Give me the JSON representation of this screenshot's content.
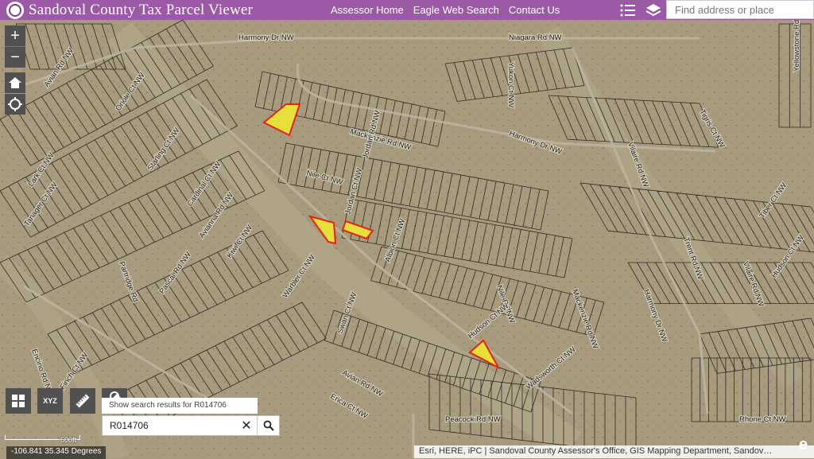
{
  "header": {
    "title": "Sandoval County Tax Parcel Viewer",
    "nav": [
      "Assessor Home",
      "Eagle Web Search",
      "Contact Us"
    ],
    "search_placeholder": "Find address or place"
  },
  "map_controls": {
    "zoom_in": "+",
    "zoom_out": "−"
  },
  "toolbar": {
    "xyz_label": "XYZ"
  },
  "search": {
    "tooltip": "Show search results for R014706",
    "value": "R014706",
    "clear": "✕"
  },
  "scale": {
    "label": "600ft"
  },
  "coords": "-106.841 35.345 Degrees",
  "attribution": "Esri, HERE, iPC | Sandoval County Assessor's Office, GIS Mapping Department, Sandov…",
  "colors": {
    "header": "#9b59a6",
    "parcel_highlight_fill": "#e7e03a",
    "parcel_highlight_stroke": "#e3241b",
    "terrain": "#a89a7c"
  },
  "map_labels": [
    {
      "name": "street-label-harmony-dr-nw-1",
      "text": "Harmony Dr NW"
    },
    {
      "name": "street-label-niagara-rd-nw",
      "text": "Niagara Rd NW"
    },
    {
      "name": "street-label-yukon-ct-nw",
      "text": "Yukon Ct NW"
    },
    {
      "name": "street-label-avian-rd-nw-1",
      "text": "Avian Rd NW"
    },
    {
      "name": "street-label-oriole-ct-nw",
      "text": "Oriole Ct NW"
    },
    {
      "name": "street-label-mackenzie-rd-nw-1",
      "text": "Mackenzie Rd NW"
    },
    {
      "name": "street-label-harmony-dr-nw-2",
      "text": "Harmony Dr NW"
    },
    {
      "name": "street-label-nile-ct-nw",
      "text": "Nile Ct NW"
    },
    {
      "name": "street-label-jordan-rd-nw",
      "text": "Jordan Rd NW"
    },
    {
      "name": "street-label-jordan-ct-nw",
      "text": "Jordan Ct NW"
    },
    {
      "name": "street-label-albion-ct-nw",
      "text": "Albion Ct NW"
    },
    {
      "name": "street-label-starling-ct-nw",
      "text": "Starling Ct NW"
    },
    {
      "name": "street-label-cardinal-ct-nw",
      "text": "Cardinal Ct NW"
    },
    {
      "name": "street-label-avianna-rd-nw",
      "text": "Avianna Rd NW"
    },
    {
      "name": "street-label-kiwi-ct-nw",
      "text": "Kiwi Ct NW"
    },
    {
      "name": "street-label-partridge-rd",
      "text": "Partridge Rd"
    },
    {
      "name": "street-label-pascal-rd-nw",
      "text": "Pascal Rd NW"
    },
    {
      "name": "street-label-warbler-ct-nw",
      "text": "Warbler Ct NW"
    },
    {
      "name": "street-label-swan-ct-nw",
      "text": "Swan Ct NW"
    },
    {
      "name": "street-label-avian-rd-nw-2",
      "text": "Avian Rd NW"
    },
    {
      "name": "street-label-finch-ct-nw",
      "text": "Finch Ct NW"
    },
    {
      "name": "street-label-encino-rd-nw",
      "text": "Encino Rd NW"
    },
    {
      "name": "street-label-tanager-ct-nw",
      "text": "Tanager Ct NW"
    },
    {
      "name": "street-label-nile-rd-nw",
      "text": "Nile Rd NW"
    },
    {
      "name": "street-label-mackenzie-rd-nw-2",
      "text": "Mackenzie Rd NW"
    },
    {
      "name": "street-label-harmony-dr-nw-3",
      "text": "Harmony Dr NW"
    },
    {
      "name": "street-label-hudson-ct-nw",
      "text": "Hudson Ct NW"
    },
    {
      "name": "street-label-wadsworth-ct-nw",
      "text": "Wadsworth Ct NW"
    },
    {
      "name": "street-label-erica-ct-nw",
      "text": "Erica Ct NW"
    },
    {
      "name": "street-label-peacock-rd-nw",
      "text": "Peacock Rd NW"
    },
    {
      "name": "street-label-rhone-ct-nw",
      "text": "Rhone Ct NW"
    },
    {
      "name": "street-label-vilaire-rd-nw-1",
      "text": "Vilaire Rd NW"
    },
    {
      "name": "street-label-vilaire-rd-nw-2",
      "text": "Vilaire Rd NW"
    },
    {
      "name": "street-label-trent-rd-nw",
      "text": "Trent Rd NW"
    },
    {
      "name": "street-label-tigris-ct-nw",
      "text": "Tigris Ct NW"
    },
    {
      "name": "street-label-tiber-ct-nw",
      "text": "Tiber Ct NW"
    },
    {
      "name": "street-label-hudson-ct-nw-2",
      "text": "Hudson Ct NW"
    },
    {
      "name": "street-label-yellowstone-rd-nw",
      "text": "Yellowstone Rd NW"
    },
    {
      "name": "street-label-lark-ct-nw",
      "text": "Lark Ct NW"
    }
  ]
}
